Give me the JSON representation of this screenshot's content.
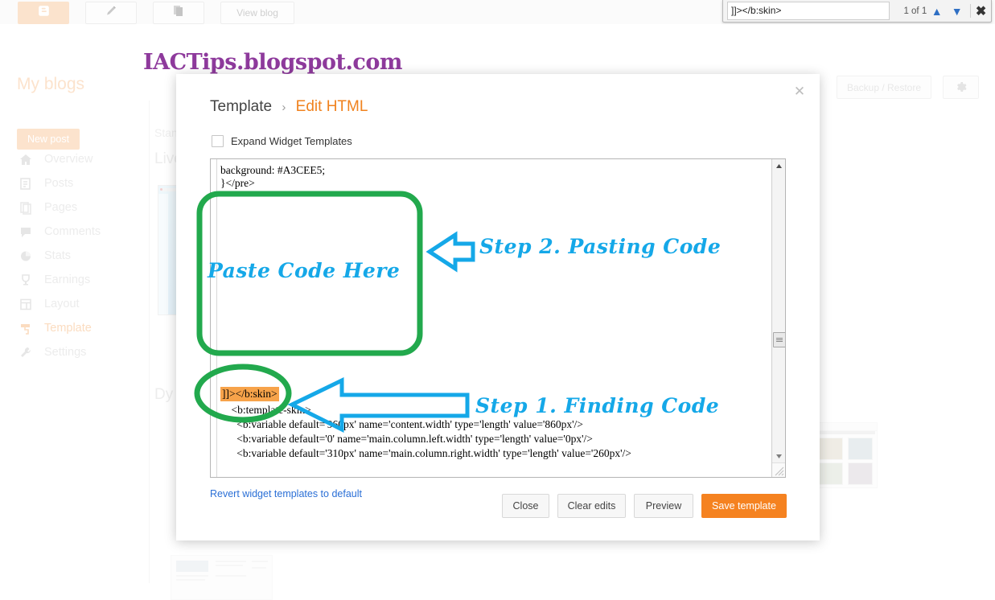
{
  "browser": {
    "find": {
      "query": "]]></b:skin>",
      "count_label": "1 of 1",
      "up_icon": "chevron-up-icon",
      "down_icon": "chevron-down-icon",
      "close_icon": "close-icon"
    }
  },
  "topbar": {
    "logo_icon": "blogger-logo-icon",
    "new_post_icon": "pencil-icon",
    "posts_icon": "pages-icon",
    "view_blog_label": "View blog"
  },
  "watermark": {
    "text": "IACTips.blogspot.com",
    "color": "#8e3a9c"
  },
  "sidebar": {
    "my_blogs_label": "My blogs",
    "new_post_label": "New post",
    "items": [
      {
        "label": "Overview",
        "icon": "home-icon",
        "active": false
      },
      {
        "label": "Posts",
        "icon": "posts-icon",
        "active": false
      },
      {
        "label": "Pages",
        "icon": "pages-icon",
        "active": false
      },
      {
        "label": "Comments",
        "icon": "comment-icon",
        "active": false
      },
      {
        "label": "Stats",
        "icon": "pie-chart-icon",
        "active": false
      },
      {
        "label": "Earnings",
        "icon": "trophy-icon",
        "active": false
      },
      {
        "label": "Layout",
        "icon": "layout-icon",
        "active": false
      },
      {
        "label": "Template",
        "icon": "paint-roller-icon",
        "active": true
      },
      {
        "label": "Settings",
        "icon": "wrench-icon",
        "active": false
      }
    ]
  },
  "background_page": {
    "section_standard": "Stan",
    "section_live": "Live",
    "section_dynamic": "Dy",
    "backup_restore_label": "Backup / Restore",
    "gear_icon": "gear-icon"
  },
  "modal": {
    "close_icon": "close-icon",
    "breadcrumb": {
      "root": "Template",
      "separator": "›",
      "current": "Edit HTML"
    },
    "expand_widget_templates_label": "Expand Widget Templates",
    "editor": {
      "lines_top": [
        "background: #A3CEE5;",
        "}</pre>"
      ],
      "highlighted_line": "]]></b:skin>",
      "lines_bottom": [
        "    <b:template-skin>",
        "      <b:variable default='960px' name='content.width' type='length' value='860px'/>",
        "      <b:variable default='0' name='main.column.left.width' type='length' value='0px'/>",
        "      <b:variable default='310px' name='main.column.right.width' type='length' value='260px'/>"
      ],
      "scrollbar": {
        "up_icon": "triangle-up-icon",
        "down_icon": "triangle-down-icon",
        "thumb": "scrollbar-thumb",
        "resize_grip": "resize-grip-icon"
      }
    },
    "footer": {
      "revert_label": "Revert widget templates to default",
      "close_label": "Close",
      "clear_edits_label": "Clear edits",
      "preview_label": "Preview",
      "save_template_label": "Save template"
    }
  },
  "annotations": {
    "accent_green": "#22a94d",
    "accent_blue": "#15a8e8",
    "highlight_orange": "#f7a34a",
    "paste_here_label": "Paste Code Here",
    "step2_label": "Step 2. Pasting Code",
    "step1_label": "Step 1. Finding Code",
    "shapes": [
      {
        "name": "green-rounded-rect",
        "target": "paste-area"
      },
      {
        "name": "green-ellipse",
        "target": "found-code"
      },
      {
        "name": "blue-arrow-left",
        "target": "step2"
      },
      {
        "name": "blue-arrow-left",
        "target": "step1"
      }
    ]
  }
}
